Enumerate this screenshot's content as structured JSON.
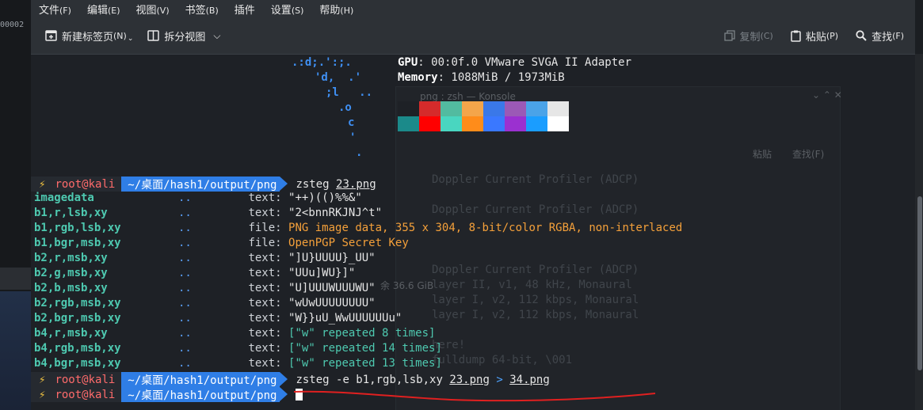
{
  "left_fragment": "00002",
  "menu": [
    {
      "label": "文件",
      "acc": "(F)"
    },
    {
      "label": "编辑",
      "acc": "(E)"
    },
    {
      "label": "视图",
      "acc": "(V)"
    },
    {
      "label": "书签",
      "acc": "(B)"
    },
    {
      "label": "插件",
      "acc": ""
    },
    {
      "label": "设置",
      "acc": "(S)"
    },
    {
      "label": "帮助",
      "acc": "(H)"
    }
  ],
  "toolbar": {
    "new_tab": "新建标签页",
    "new_tab_acc": "(N)",
    "split_view": "拆分视图",
    "copy": "复制",
    "copy_acc": "(C)",
    "paste": "粘贴",
    "paste_acc": "(P)",
    "find": "查找",
    "find_acc": "(F)"
  },
  "ascii_art": [
    ".:d;.':;.",
    "'d,  .'",
    ";l   ..",
    ".o",
    "c",
    "'",
    "."
  ],
  "sysinfo": {
    "gpu_key": "GPU",
    "gpu_val": ": 00:0f.0 VMware SVGA II Adapter",
    "mem_key": "Memory",
    "mem_val": ": 1088MiB / 1973MiB"
  },
  "palette": {
    "row1": [
      "#1e2126",
      "#d52b2b",
      "#52bba0",
      "#f4a54a",
      "#3a78e8",
      "#9b59b6",
      "#4aa3e8",
      "#e6e6e6"
    ],
    "row2": [
      "#1b8a8a",
      "#ff0000",
      "#49d6c0",
      "#ff8c1a",
      "#3a78ff",
      "#9b30d0",
      "#1a9dff",
      "#ffffff"
    ]
  },
  "ghost": {
    "title": "png : zsh — Konsole",
    "paste": "粘贴",
    "find": "查找(F)",
    "size": "余 36.6 GiB",
    "lines": [
      "Doppler Current Profiler (ADCP)",
      "Doppler Current Profiler (ADCP)",
      "Doppler Current Profiler (ADCP)",
      "layer II, v1, 48 kHz, Monaural",
      "layer I, v2, 112 kbps, Monaural",
      "layer I, v2, 112 kbps, Monaural",
      "here!",
      "fulldump 64-bit, \\001"
    ]
  },
  "prompt": {
    "bolt": "⚡",
    "user": "root@kali",
    "path": "~/桌面/hash1/output/png"
  },
  "commands": {
    "c1_prog": "zsteg",
    "c1_file": "23.png",
    "c2_prog": "zsteg -e b1,rgb,lsb,xy",
    "c2_file": "23.png",
    "c2_gt": ">",
    "c2_out": "34.png"
  },
  "results": [
    {
      "name": "imagedata",
      "dots": "..",
      "type": "text:",
      "val": "\"++)(()%%&\"",
      "style": ""
    },
    {
      "name": "b1,r,lsb,xy",
      "dots": "..",
      "type": "text:",
      "val": "\"2<bnnRKJNJ^t\"",
      "style": ""
    },
    {
      "name": "b1,rgb,lsb,xy",
      "dots": "..",
      "type": "file:",
      "val": "PNG image data, 355 x 304, 8-bit/color RGBA, non-interlaced",
      "style": "orange"
    },
    {
      "name": "b1,bgr,msb,xy",
      "dots": "..",
      "type": "file:",
      "val": "OpenPGP Secret Key",
      "style": "orange"
    },
    {
      "name": "b2,r,msb,xy",
      "dots": "..",
      "type": "text:",
      "val": "\"]U}UUUU}_UU\"",
      "style": ""
    },
    {
      "name": "b2,g,msb,xy",
      "dots": "..",
      "type": "text:",
      "val": "\"UUu]WU}]\"",
      "style": ""
    },
    {
      "name": "b2,b,msb,xy",
      "dots": "..",
      "type": "text:",
      "val": "\"U]UUUWUUUWU\"",
      "style": ""
    },
    {
      "name": "b2,rgb,msb,xy",
      "dots": "..",
      "type": "text:",
      "val": "\"wUwUUUUUUUU\"",
      "style": ""
    },
    {
      "name": "b2,bgr,msb,xy",
      "dots": "..",
      "type": "text:",
      "val": "\"W}}uU_WwUUUUUUu\"",
      "style": ""
    },
    {
      "name": "b4,r,msb,xy",
      "dots": "..",
      "type": "text:",
      "val": "[\"w\" repeated 8 times]",
      "style": "teal"
    },
    {
      "name": "b4,rgb,msb,xy",
      "dots": "..",
      "type": "text:",
      "val": "[\"w\" repeated 14 times]",
      "style": "teal"
    },
    {
      "name": "b4,bgr,msb,xy",
      "dots": "..",
      "type": "text:",
      "val": "[\"w\" repeated 13 times]",
      "style": "teal"
    }
  ]
}
